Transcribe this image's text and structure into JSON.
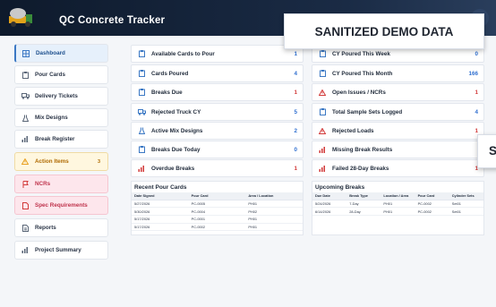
{
  "header": {
    "app_title": "QC Concrete Tracker"
  },
  "watermark": {
    "text": "SANITIZED DEMO DATA",
    "partial_text": "S"
  },
  "sidebar": {
    "items": [
      {
        "label": "Dashboard",
        "icon": "dashboard-icon"
      },
      {
        "label": "Pour Cards",
        "icon": "clipboard-icon"
      },
      {
        "label": "Delivery Tickets",
        "icon": "truck-icon"
      },
      {
        "label": "Mix Designs",
        "icon": "flask-icon"
      },
      {
        "label": "Break Register",
        "icon": "bar-chart-icon"
      },
      {
        "label": "Action Items",
        "icon": "warning-icon",
        "badge": "3"
      },
      {
        "label": "NCRs",
        "icon": "flag-icon"
      },
      {
        "label": "Spec Requirements",
        "icon": "document-icon"
      },
      {
        "label": "Reports",
        "icon": "document-icon"
      },
      {
        "label": "Project Summary",
        "icon": "bar-chart-icon"
      }
    ]
  },
  "stats": {
    "left": [
      {
        "label": "Available Cards to Pour",
        "value": "1"
      },
      {
        "label": "Cards Poured",
        "value": "4"
      },
      {
        "label": "Breaks Due",
        "value": "1"
      },
      {
        "label": "Rejected Truck CY",
        "value": "5"
      },
      {
        "label": "Active Mix Designs",
        "value": "2"
      },
      {
        "label": "Breaks Due Today",
        "value": "0"
      },
      {
        "label": "Overdue Breaks",
        "value": "1"
      }
    ],
    "right": [
      {
        "label": "CY Poured This Week",
        "value": "0"
      },
      {
        "label": "CY Poured This Month",
        "value": "166"
      },
      {
        "label": "Open Issues / NCRs",
        "value": "1"
      },
      {
        "label": "Total Sample Sets Logged",
        "value": "4"
      },
      {
        "label": "Rejected Loads",
        "value": "1"
      },
      {
        "label": "Missing Break Results",
        "value": ""
      },
      {
        "label": "Failed 28-Day Breaks",
        "value": "1"
      }
    ]
  },
  "recent_pours": {
    "title": "Recent Pour Cards",
    "columns": [
      "Date Signed",
      "Pour Card",
      "Area / Location"
    ],
    "rows": [
      [
        "5/27/2026",
        "PC-0005",
        "PH01"
      ],
      [
        "5/30/2026",
        "PC-0004",
        "PH02"
      ],
      [
        "5/17/2026",
        "PC-0001",
        "PH01"
      ],
      [
        "5/17/2026",
        "PC-0002",
        "PH01"
      ]
    ]
  },
  "upcoming_breaks": {
    "title": "Upcoming Breaks",
    "columns": [
      "Due Date",
      "Break Type",
      "Location / Area",
      "Pour Card",
      "Cylinder Sets"
    ],
    "rows": [
      [
        "5/24/2026",
        "7-Day",
        "PH01",
        "PC-0002",
        "Set01"
      ],
      [
        "6/14/2026",
        "28-Day",
        "PH01",
        "PC-0002",
        "Set01"
      ]
    ]
  },
  "colors": {
    "accent": "#2f6fd0",
    "danger": "#d23a3a",
    "header_bg": "#0e1a2c",
    "warning": "#e8a020"
  }
}
